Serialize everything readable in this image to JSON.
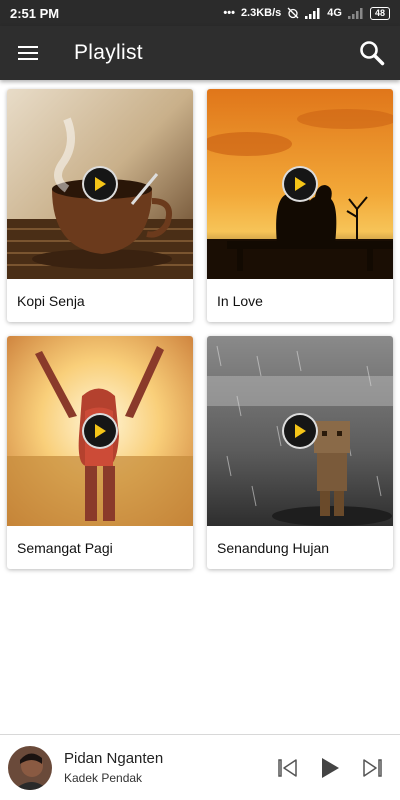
{
  "status_bar": {
    "time": "2:51 PM",
    "dots": "•••",
    "speed": "2.3KB/s",
    "network": "4G",
    "battery": "48"
  },
  "app_bar": {
    "title": "Playlist",
    "menu_icon": "hamburger-icon",
    "search_icon": "search-icon"
  },
  "playlist": [
    {
      "label": "Kopi Senja",
      "art": "coffee-cup-image"
    },
    {
      "label": "In Love",
      "art": "couple-sunset-image"
    },
    {
      "label": "Semangat Pagi",
      "art": "woman-sunrise-image"
    },
    {
      "label": "Senandung Hujan",
      "art": "rain-figure-image"
    }
  ],
  "now_playing": {
    "title": "Pidan Nganten",
    "artist": "Kadek Pendak",
    "controls": [
      "skip-previous-icon",
      "play-icon",
      "skip-next-icon"
    ]
  },
  "colors": {
    "app_bar": "#2e2e2e",
    "status_bar": "#2b2b2b",
    "play_accent": "#f5c518"
  }
}
